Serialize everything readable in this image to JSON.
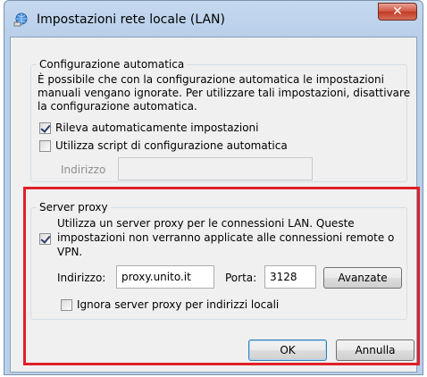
{
  "window": {
    "title": "Impostazioni rete locale (LAN)",
    "close_label": "✕"
  },
  "auto_config": {
    "legend": "Configurazione automatica",
    "description_lines": [
      "È possibile che con la configurazione automatica le impostazioni",
      "manuali vengano ignorate. Per utilizzare tali impostazioni, disattivare",
      "la configurazione automatica."
    ],
    "detect_label": "Rileva automaticamente impostazioni",
    "detect_checked": true,
    "script_label": "Utilizza script di configurazione automatica",
    "script_checked": false,
    "address_label": "Indirizzo",
    "address_value": ""
  },
  "proxy": {
    "legend": "Server proxy",
    "use_proxy_lines": [
      "Utilizza un server proxy per le connessioni LAN. Queste",
      "impostazioni non verranno applicate alle connessioni remote o",
      "VPN."
    ],
    "use_proxy_checked": true,
    "address_label": "Indirizzo:",
    "address_value": "proxy.unito.it",
    "port_label": "Porta:",
    "port_value": "3128",
    "advanced_label": "Avanzate",
    "bypass_label": "Ignora server proxy per indirizzi locali",
    "bypass_checked": false
  },
  "buttons": {
    "ok": "OK",
    "cancel": "Annulla"
  },
  "colors": {
    "highlight": "#e0202a",
    "titlebar": "#b9cfea"
  }
}
